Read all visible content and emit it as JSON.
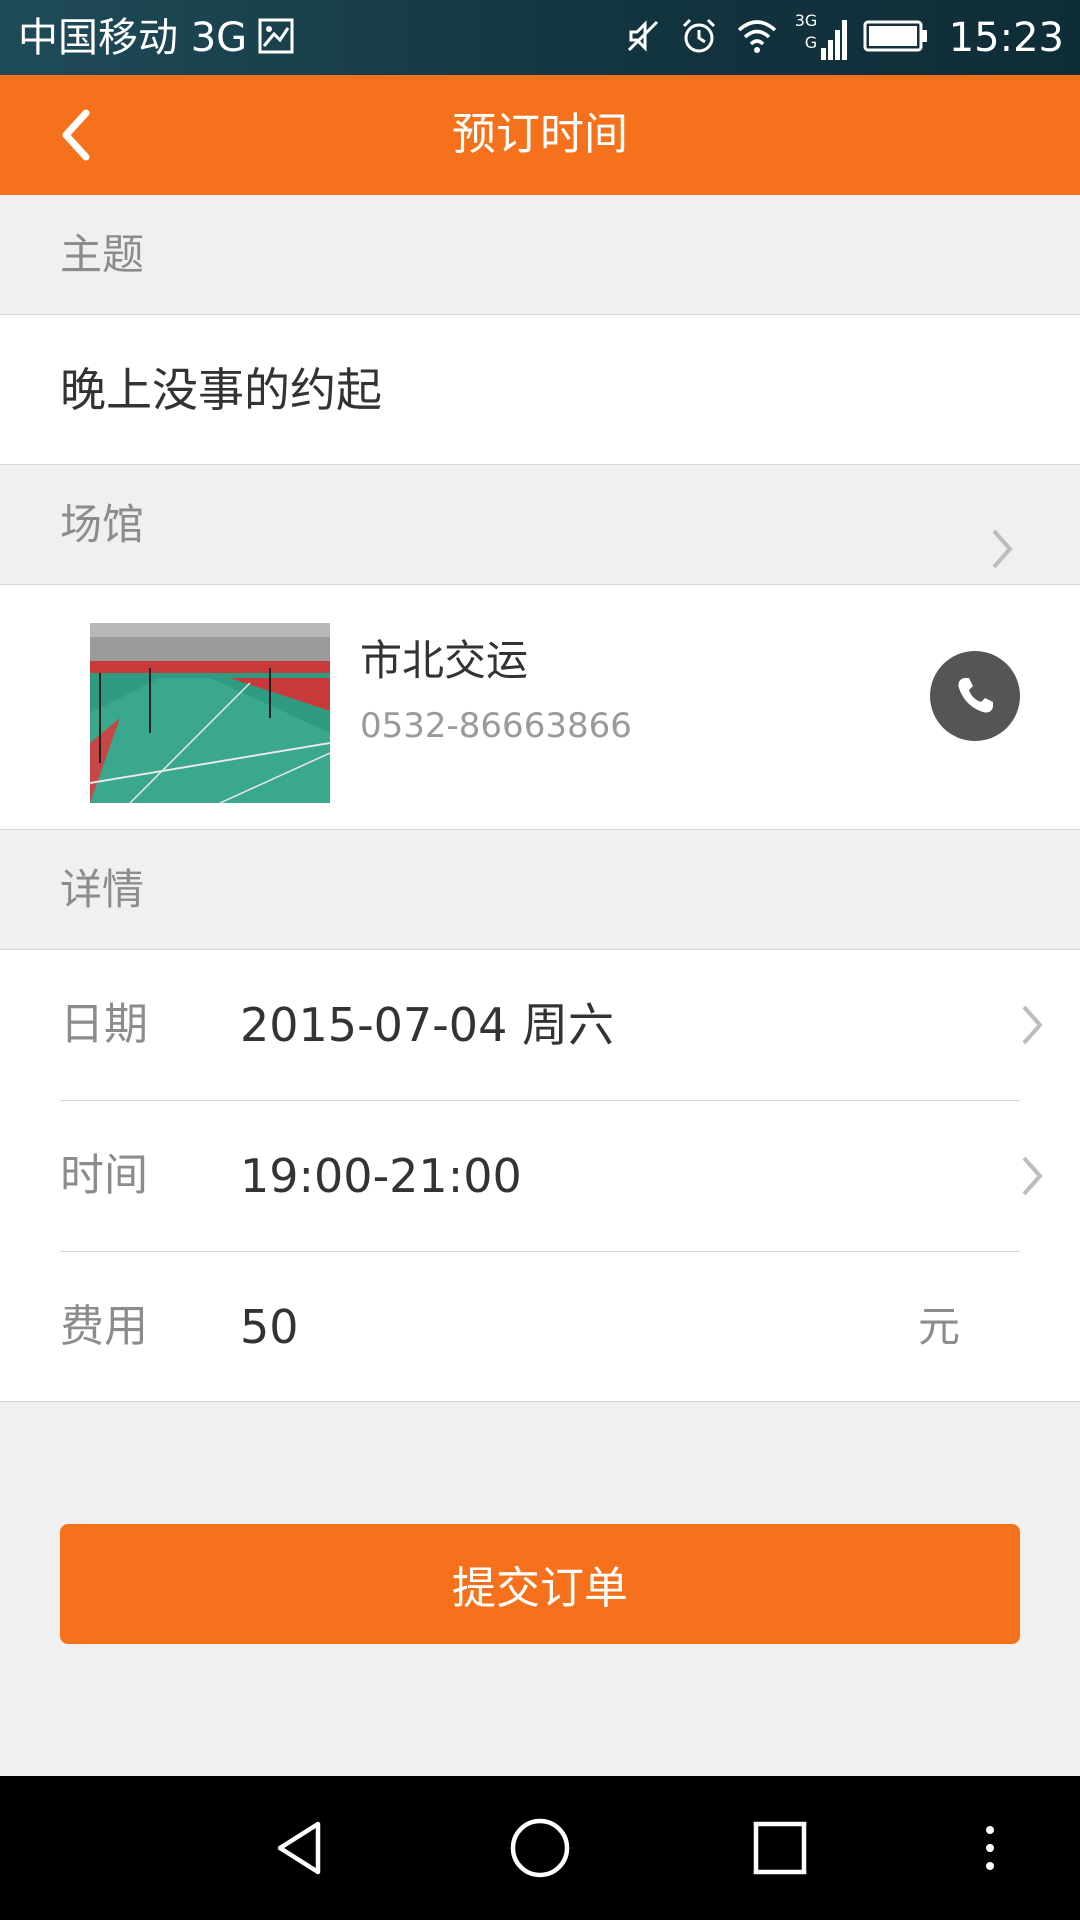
{
  "status_bar": {
    "carrier": "中国移动 3G",
    "network_badge_top": "3G",
    "network_badge_bottom": "G",
    "time": "15:23"
  },
  "app_bar": {
    "title": "预订时间",
    "back_icon": "chevron-left-icon"
  },
  "topic": {
    "header": "主题",
    "value": "晚上没事的约起"
  },
  "venue": {
    "header": "场馆",
    "name": "市北交运",
    "phone": "0532-86663866",
    "call_icon": "phone-icon"
  },
  "details": {
    "header": "详情",
    "rows": [
      {
        "label": "日期",
        "value": "2015-07-04 周六"
      },
      {
        "label": "时间",
        "value": "19:00-21:00"
      },
      {
        "label": "费用",
        "value": "50",
        "unit": "元"
      }
    ]
  },
  "submit_button": "提交订单",
  "nav_bar": {
    "icons": [
      "back-triangle-icon",
      "home-circle-icon",
      "recents-square-icon",
      "more-dots-icon"
    ]
  },
  "colors": {
    "accent": "#f6711b",
    "background": "#f0f0f0",
    "status_bar": "#12343f"
  }
}
